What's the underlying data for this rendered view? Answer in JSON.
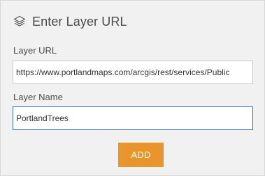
{
  "header": {
    "icon": "layers-icon",
    "title": "Enter Layer URL"
  },
  "form": {
    "url_label": "Layer URL",
    "url_value": "https://www.portlandmaps.com/arcgis/rest/services/Public",
    "name_label": "Layer Name",
    "name_value": "PortlandTrees",
    "add_button_label": "ADD"
  },
  "colors": {
    "panel_bg": "#f1f1f1",
    "accent": "#e8952c",
    "focus_border": "#3c6fb6"
  }
}
